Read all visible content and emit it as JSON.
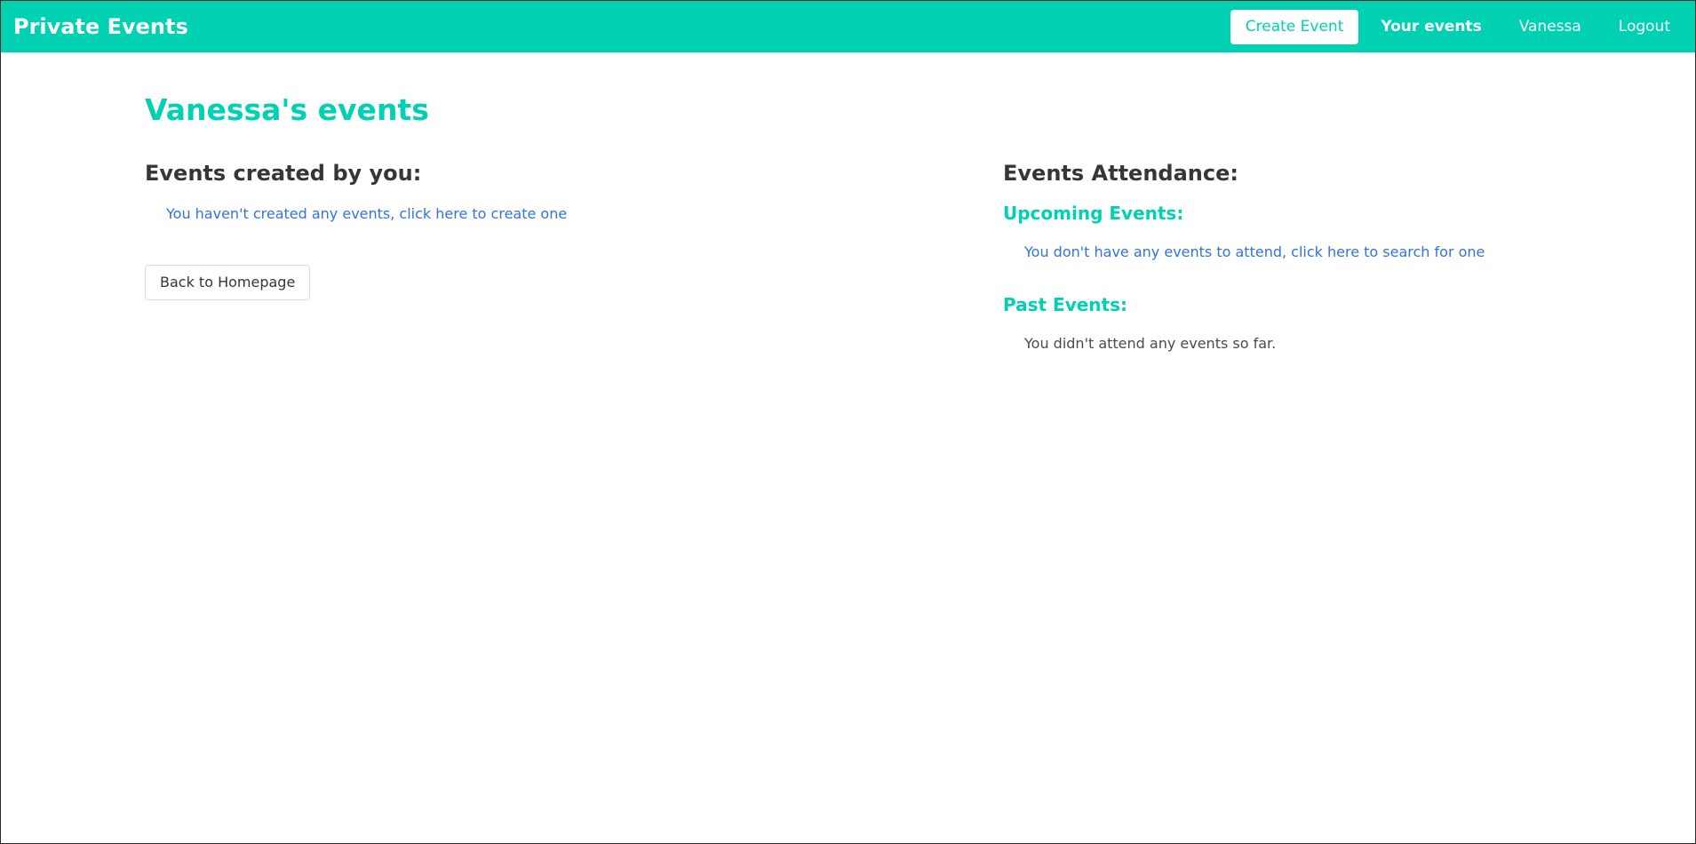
{
  "navbar": {
    "brand": "Private Events",
    "create_event": "Create Event",
    "your_events": "Your events",
    "user": "Vanessa",
    "logout": "Logout"
  },
  "page": {
    "title": "Vanessa's events"
  },
  "created": {
    "heading": "Events created by you:",
    "empty_link": "You haven't created any events, click here to create one",
    "back_button": "Back to Homepage"
  },
  "attendance": {
    "heading": "Events Attendance:",
    "upcoming_heading": "Upcoming Events:",
    "upcoming_empty_link": "You don't have any events to attend, click here to search for one",
    "past_heading": "Past Events:",
    "past_empty": "You didn't attend any events so far."
  },
  "colors": {
    "primary": "#00d1b2",
    "link": "#3273dc",
    "text": "#4a4a4a"
  }
}
